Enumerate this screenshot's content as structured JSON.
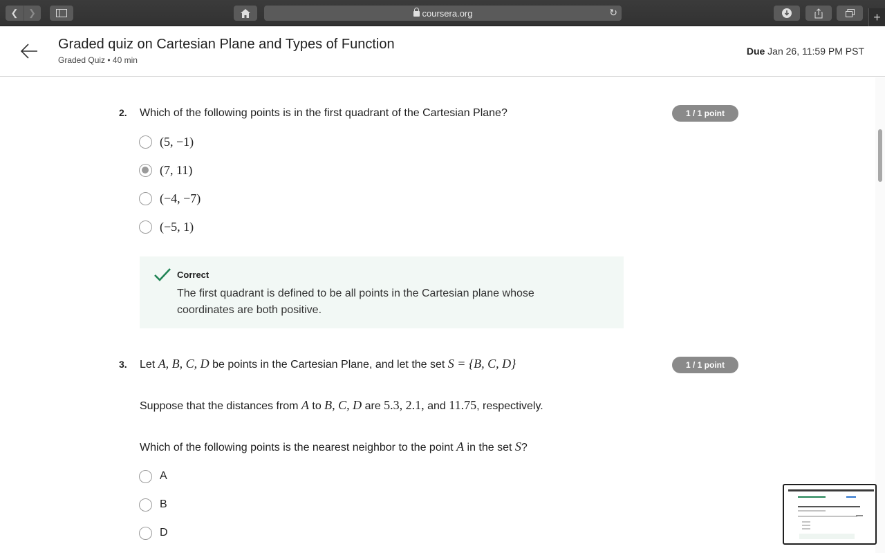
{
  "browser": {
    "url": "coursera.org"
  },
  "header": {
    "title": "Graded quiz on Cartesian Plane and Types of Function",
    "subtitle": "Graded Quiz • 40 min",
    "due_label": "Due",
    "due_value": "Jan 26, 11:59 PM PST"
  },
  "questions": [
    {
      "number": "2.",
      "text": "Which of the following points is in the first quadrant of the Cartesian Plane?",
      "points": "1 / 1 point",
      "options": [
        {
          "label": "(5, −1)",
          "selected": false
        },
        {
          "label": "(7, 11)",
          "selected": true
        },
        {
          "label": "(−4, −7)",
          "selected": false
        },
        {
          "label": "(−5, 1)",
          "selected": false
        }
      ],
      "feedback": {
        "title": "Correct",
        "text": "The first quadrant is defined to be all points in the Cartesian plane whose coordinates are both positive."
      }
    },
    {
      "number": "3.",
      "points": "1 / 1 point",
      "line1_pre": "Let ",
      "line1_math1": "A, B, C, D",
      "line1_mid": " be points in the Cartesian Plane, and let the set ",
      "line1_math2": "S = {B, C, D}",
      "line2_pre": "Suppose that the distances from ",
      "line2_math1": "A",
      "line2_to": " to ",
      "line2_math2": "B, C, D",
      "line2_are": " are ",
      "line2_values": "5.3, 2.1,",
      "line2_and": " and ",
      "line2_last": "11.75",
      "line2_end": ", respectively.",
      "line3_pre": "Which of the following points is the nearest neighbor to the point ",
      "line3_math1": "A",
      "line3_mid": " in the set ",
      "line3_math2": "S",
      "line3_end": "?",
      "options": [
        {
          "label": "A",
          "selected": false
        },
        {
          "label": "B",
          "selected": false
        },
        {
          "label": "D",
          "selected": false
        }
      ]
    }
  ],
  "colors": {
    "feedback_bg": "#f2f8f5",
    "check_green": "#1f8354",
    "badge_gray": "#8a8a8a"
  }
}
